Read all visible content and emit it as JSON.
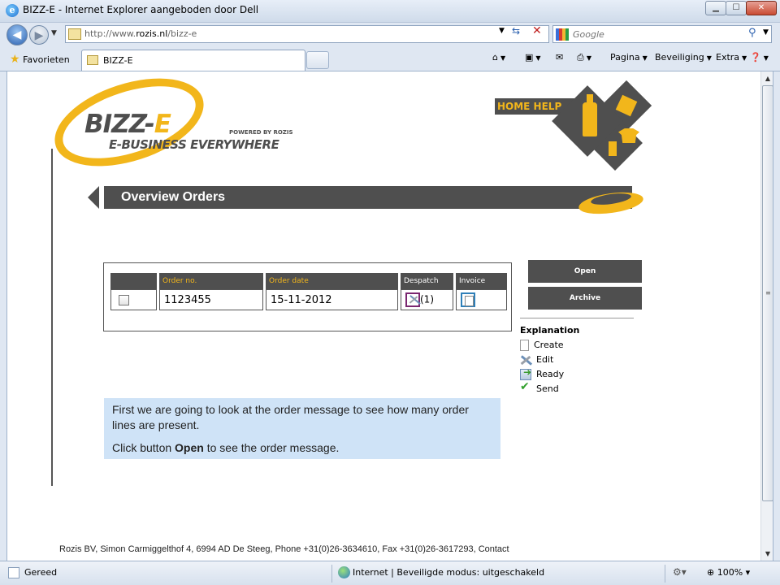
{
  "window": {
    "title": "BIZZ-E - Internet Explorer aangeboden door Dell",
    "minimize_glyph": "▁",
    "maximize_glyph": "☐",
    "close_glyph": "✕"
  },
  "address_bar": {
    "url_prefix": "http://www.",
    "url_domain": "rozis.nl",
    "url_path": "/bizz-e"
  },
  "search": {
    "placeholder": "Google"
  },
  "favorites": {
    "label": "Favorieten"
  },
  "tab": {
    "label": "BIZZ-E"
  },
  "command_bar": {
    "pagina": "Pagina",
    "beveiliging": "Beveiliging",
    "extra": "Extra"
  },
  "site": {
    "logo_brand_main": "BIZZ-",
    "logo_brand_accent": "E",
    "logo_powered": "POWERED BY ROZIS",
    "logo_tagline": "E-BUSINESS EVERYWHERE",
    "home_help": "HOME HELP",
    "page_title": "Overview Orders"
  },
  "orders_table": {
    "columns": [
      "",
      "Order no.",
      "Order date",
      "Despatch",
      "Invoice"
    ],
    "rows": [
      {
        "order_no": "1123455",
        "order_date": "15-11-2012",
        "despatch_count": "(1)"
      }
    ]
  },
  "actions": {
    "open": "Open",
    "archive": "Archive"
  },
  "legend": {
    "title": "Explanation",
    "items": [
      "Create",
      "Edit",
      "Ready",
      "Send"
    ]
  },
  "instruction": {
    "line1": "First we are going to look at the order message to see how many order lines are present.",
    "line2_prefix": "Click button ",
    "line2_bold": "Open",
    "line2_suffix": " to see the order message."
  },
  "footer": "Rozis BV, Simon Carmiggelthof 4, 6994 AD De Steeg, Phone +31(0)26-3634610, Fax +31(0)26-3617293, Contact",
  "status_bar": {
    "status": "Gereed",
    "zone": "Internet | Beveiligde modus: uitgeschakeld",
    "zoom": "100%"
  },
  "colors": {
    "brand_yellow": "#f2b61b",
    "brand_dark": "#4f4f4f",
    "instruction_bg": "#cfe3f7"
  }
}
